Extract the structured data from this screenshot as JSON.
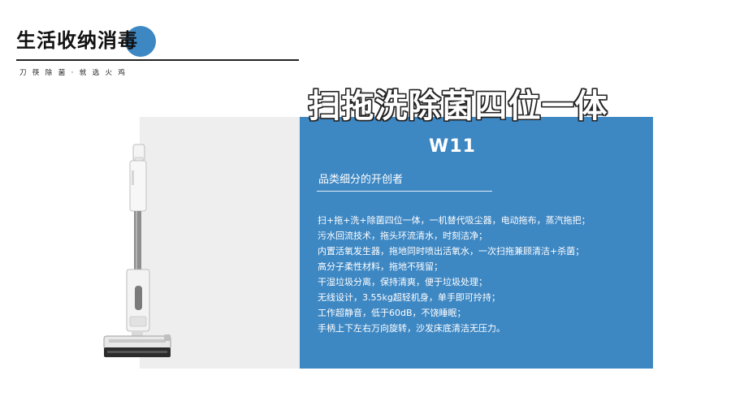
{
  "header": {
    "title": "生活收纳消毒",
    "subtitle": "刀筷除菌·就选火鸡"
  },
  "heading": "扫拖洗除菌四位一体",
  "product": {
    "model": "W11",
    "tagline": "品类细分的开创者",
    "features": [
      "扫+拖+洗+除菌四位一体，一机替代吸尘器，电动拖布，蒸汽拖把；",
      "污水回流技术，拖头环流清水，时刻洁净；",
      "内置活氧发生器，拖地同时喷出活氧水，一次扫拖兼顾清洁+杀菌；",
      "高分子柔性材料，拖地不残留；",
      "干湿垃圾分离，保持清爽，便于垃圾处理；",
      "无线设计，3.55kg超轻机身，单手即可拎持；",
      "工作超静音，低于60dB，不饶睡眠；",
      "手柄上下左右万向旋转，沙发床底清洁无压力。"
    ]
  },
  "colors": {
    "accent_blue": "#3d87c3",
    "panel_grey": "#eeeeee"
  }
}
